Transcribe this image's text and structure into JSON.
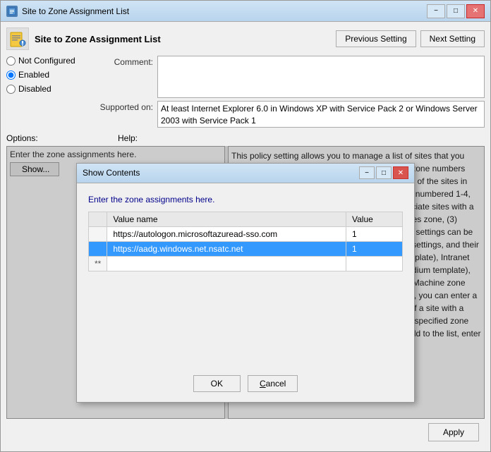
{
  "window": {
    "title": "Site to Zone Assignment List",
    "minimize_label": "−",
    "maximize_label": "□",
    "close_label": "✕"
  },
  "header": {
    "icon_label": "policy-icon",
    "title": "Site to Zone Assignment List"
  },
  "nav": {
    "previous_label": "Previous Setting",
    "next_label": "Next Setting"
  },
  "radio": {
    "not_configured_label": "Not Configured",
    "enabled_label": "Enabled",
    "disabled_label": "Disabled",
    "selected": "enabled"
  },
  "comment": {
    "label": "Comment:",
    "placeholder": ""
  },
  "supported": {
    "label": "Supported on:",
    "value": "At least Internet Explorer 6.0 in Windows XP with Service Pack 2 or Windows Server 2003 with Service Pack 1"
  },
  "options_label": "Options:",
  "help_label": "Help:",
  "left_panel": {
    "text": "Enter the zone assignments here.",
    "show_label": "Show..."
  },
  "right_panel": {
    "text": "This policy setting allows you to manage a list of sites that you associate with a particular security zone. These zone numbers have associated security settings that apply to all of the sites in the zone.\n\nInternet Explorer has 4 security zones, numbered 1-4, and these are used by this policy setting to associate sites with a zone. They are: (1) Intranet zone, (2) Trusted Sites zone, (3) Internet zone, (4) Restricted Sites zone. Security settings can be set for each of these zones through other policy settings, and their default settings are: Trusted Sites zone (Low template), Intranet zone (Medium-Low template), Internet zone (Medium template), and Restricted Sites zone (High template). (The Machine zone assignment, and)\n\nIf you enable this policy setting, you can enter a list of sites and zone numbers. The association of a site with a zone will ensure that the security settings for the specified zone are applied to the site. For each entry that you add to the list, enter"
  },
  "bottom": {
    "apply_label": "Apply"
  },
  "dialog": {
    "title": "Show Contents",
    "minimize_label": "−",
    "maximize_label": "□",
    "close_label": "✕",
    "intro_text": "Enter the zone assignments here.",
    "table": {
      "col_value_name": "Value name",
      "col_value": "Value",
      "rows": [
        {
          "marker": "",
          "name": "https://autologon.microsoftazuread-sso.com",
          "value": "1",
          "selected": false
        },
        {
          "marker": "",
          "name": "https://aadg.windows.net.nsatc.net",
          "value": "1",
          "selected": true
        },
        {
          "marker": "**",
          "name": "",
          "value": "",
          "selected": false
        }
      ]
    },
    "ok_label": "OK",
    "cancel_label": "Cancel",
    "cancel_underline": "C"
  }
}
